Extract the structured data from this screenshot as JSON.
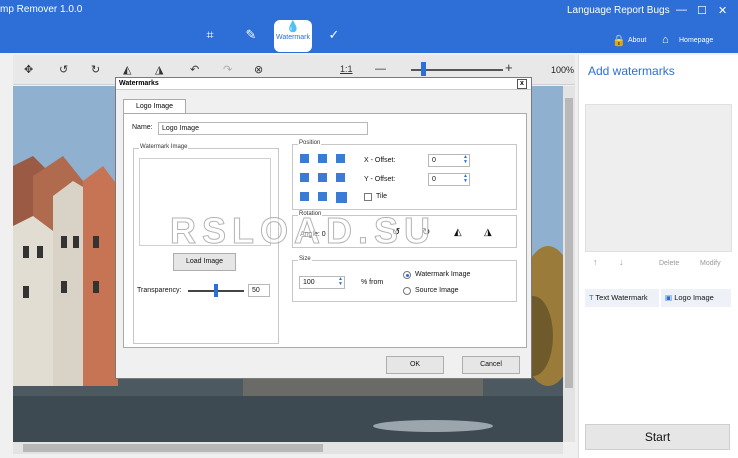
{
  "titlebar": {
    "app_title": "mp Remover 1.0.0",
    "modes": [
      {
        "icon": "crop-icon",
        "glyph": "⌗"
      },
      {
        "icon": "brush-icon",
        "glyph": "✎"
      },
      {
        "icon": "watermark-icon",
        "glyph": "💧",
        "label": "Watermark"
      },
      {
        "icon": "check-icon",
        "glyph": "✓"
      }
    ],
    "language": "Language",
    "report_bugs": "Report Bugs",
    "about": "About",
    "homepage": "Homepage",
    "minimize": "—",
    "maximize": "☐",
    "close": "✕"
  },
  "toolbar": {
    "zoom_fit": "1:1",
    "zoom_minus": "—",
    "zoom_plus": "+",
    "zoom_percent": "100%"
  },
  "right_panel": {
    "title": "Add watermarks",
    "up": "↑",
    "down": "↓",
    "delete": "Delete",
    "modify": "Modify",
    "text_watermark": "Text Watermark",
    "logo_image": "Logo Image",
    "start": "Start"
  },
  "dialog": {
    "title": "Watermarks",
    "close": "x",
    "tab": "Logo Image",
    "name_label": "Name:",
    "name_value": "Logo Image",
    "watermark_image_group": "Watermark Image",
    "load_image": "Load Image",
    "transparency_label": "Transparency:",
    "transparency_value": "50",
    "position_group": "Position",
    "x_offset_label": "X - Offset:",
    "x_offset_value": "0",
    "y_offset_label": "Y - Offset:",
    "y_offset_value": "0",
    "tile_label": "Tile",
    "rotation_group": "Rotation",
    "angle_label": "Angle: 0",
    "size_group": "Size",
    "size_value": "100",
    "percent_from": "% from",
    "watermark_image_option": "Watermark Image",
    "source_image_option": "Source Image",
    "ok": "OK",
    "cancel": "Cancel"
  },
  "overlay_text": "RSLOAD.SU"
}
